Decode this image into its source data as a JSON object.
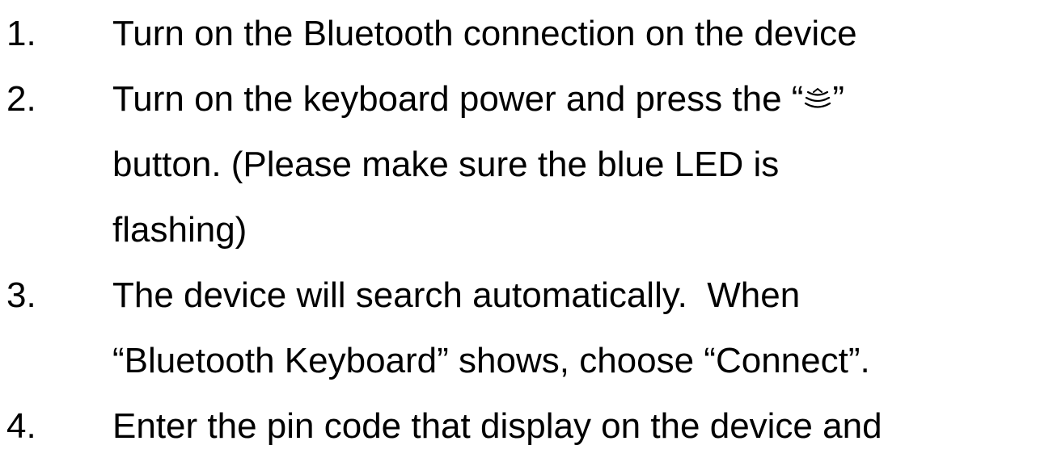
{
  "steps": [
    {
      "number": "1.",
      "lines": [
        "Turn on the Bluetooth connection on the device"
      ]
    },
    {
      "number": "2.",
      "line1_before_icon": "Turn on the keyboard power and press the “",
      "icon": "bluetooth-connect-waves-icon",
      "line1_after_icon": "”",
      "lines": [
        "button. (Please make sure the blue LED is",
        "flashing)"
      ]
    },
    {
      "number": "3.",
      "lines": [
        "The device will search automatically.  When",
        "“Bluetooth Keyboard” shows, choose “Connect”."
      ]
    },
    {
      "number": "4.",
      "lines": [
        "Enter the pin code that display on the device and"
      ]
    }
  ]
}
